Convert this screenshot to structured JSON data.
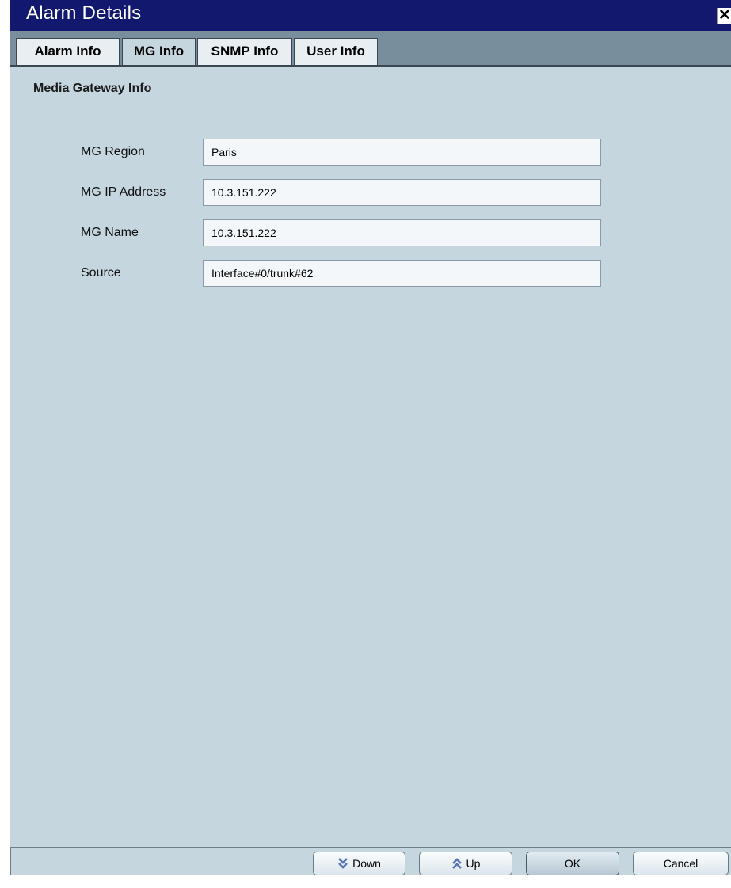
{
  "window": {
    "title": "Alarm Details",
    "close_symbol": "✕"
  },
  "tabs": [
    {
      "label": "Alarm Info",
      "active": false
    },
    {
      "label": "MG Info",
      "active": true
    },
    {
      "label": "SNMP Info",
      "active": false
    },
    {
      "label": "User Info",
      "active": false
    }
  ],
  "section": {
    "title": "Media Gateway Info"
  },
  "fields": [
    {
      "label": "MG Region",
      "value": "Paris"
    },
    {
      "label": "MG IP Address",
      "value": "10.3.151.222"
    },
    {
      "label": "MG Name",
      "value": "10.3.151.222"
    },
    {
      "label": "Source",
      "value": "Interface#0/trunk#62"
    }
  ],
  "buttons": {
    "down": {
      "label": "Down",
      "icon": "double-chevron-down-icon"
    },
    "up": {
      "label": "Up",
      "icon": "double-chevron-up-icon"
    },
    "ok": {
      "label": "OK"
    },
    "cancel": {
      "label": "Cancel"
    }
  },
  "colors": {
    "titlebar": "#12186e",
    "tabbar": "#788e9d",
    "panel": "#c5d6de",
    "icon_blue": "#5876b8"
  }
}
